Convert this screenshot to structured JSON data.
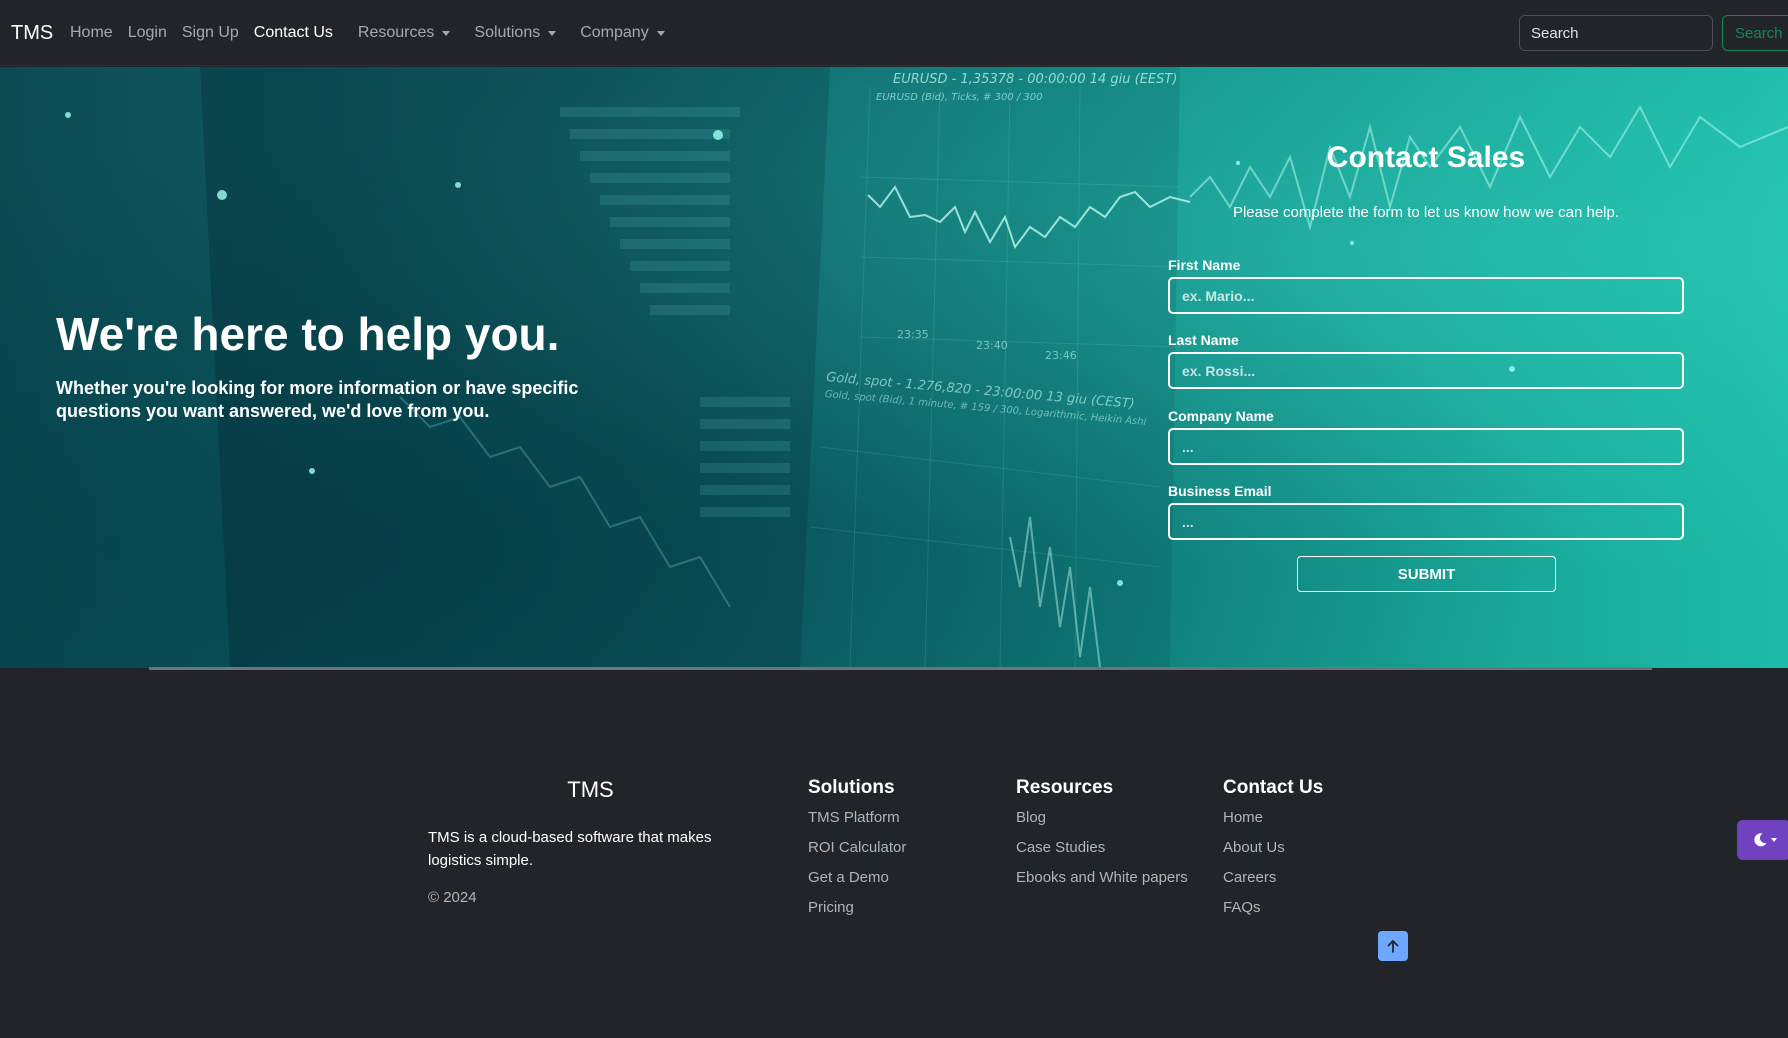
{
  "navbar": {
    "brand": "TMS",
    "links": [
      "Home",
      "Login",
      "Sign Up",
      "Contact Us"
    ],
    "dropdowns": [
      "Resources",
      "Solutions",
      "Company"
    ],
    "search_placeholder": "Search",
    "search_button": "Search"
  },
  "hero": {
    "title": "We're here to help you.",
    "subtitle": "Whether you're looking for more information or have specific questions you want answered, we'd love from you.",
    "background_text": {
      "chart1_title": "EURUSD - 1,35378 - 00:00:00 14 giu (EEST)",
      "chart1_sub": "EURUSD (Bid), Ticks, # 300 / 300",
      "chart1_times": [
        "23:35",
        "23:40",
        "23:46"
      ],
      "chart2_title": "Gold, spot - 1.276,820 - 23:00:00 13 giu (CEST)",
      "chart2_sub": "Gold, spot (Bid), 1 minute, # 159 / 300, Logarithmic, Heikin Ashi"
    }
  },
  "form": {
    "title": "Contact Sales",
    "description": "Please complete the form to let us know how we can help.",
    "fields": [
      {
        "label": "First Name",
        "placeholder": "ex. Mario..."
      },
      {
        "label": "Last Name",
        "placeholder": "ex. Rossi..."
      },
      {
        "label": "Company Name",
        "placeholder": "..."
      },
      {
        "label": "Business Email",
        "placeholder": "..."
      }
    ],
    "submit": "SUBMIT"
  },
  "footer": {
    "brand": "TMS",
    "description": "TMS is a cloud-based software that makes logistics simple.",
    "copyright": "© 2024",
    "columns": [
      {
        "title": "Solutions",
        "links": [
          "TMS Platform",
          "ROI Calculator",
          "Get a Demo",
          "Pricing"
        ]
      },
      {
        "title": "Resources",
        "links": [
          "Blog",
          "Case Studies",
          "Ebooks and White papers"
        ]
      },
      {
        "title": "Contact Us",
        "links": [
          "Home",
          "About Us",
          "Careers",
          "FAQs"
        ]
      }
    ]
  },
  "colors": {
    "navbar_bg": "#212529",
    "hero_teal": "#19a99a",
    "search_green": "#198754",
    "back_to_top": "#6ea8fe",
    "theme_toggle": "#6f42c1"
  },
  "icons": [
    "arrow-up-icon",
    "moon-icon",
    "chevron-down-icon"
  ]
}
